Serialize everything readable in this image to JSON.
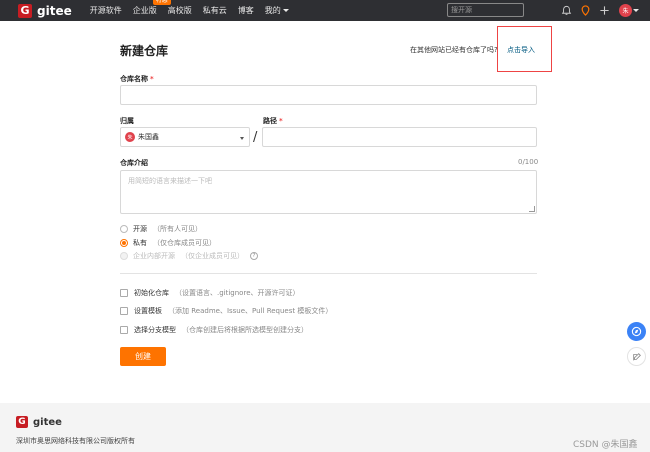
{
  "topbar": {
    "logo_letter": "G",
    "logo_text": "gitee",
    "nav": [
      {
        "label": "开源软件"
      },
      {
        "label": "企业版",
        "badge": "特惠"
      },
      {
        "label": "高校版"
      },
      {
        "label": "私有云"
      },
      {
        "label": "博客"
      },
      {
        "label": "我的"
      }
    ],
    "search_placeholder": "搜开源",
    "avatar_text": "朱"
  },
  "page": {
    "title": "新建仓库",
    "import_question": "在其他网站已经有仓库了吗?",
    "import_link": "点击导入"
  },
  "form": {
    "repo_name_label": "仓库名称",
    "required_mark": "*",
    "owner_label": "归属",
    "owner_avatar": "朱",
    "owner_name": "朱国鑫",
    "path_label": "路径",
    "path_separator": "/",
    "intro_label": "仓库介绍",
    "intro_counter": "0/100",
    "intro_placeholder": "用简短的语言来描述一下吧",
    "visibility": [
      {
        "label": "开源",
        "hint": "（所有人可见）",
        "state": "off"
      },
      {
        "label": "私有",
        "hint": "（仅仓库成员可见）",
        "state": "on"
      },
      {
        "label": "企业内部开源",
        "hint": "（仅企业成员可见）",
        "state": "disabled"
      }
    ],
    "options": [
      {
        "label": "初始化仓库",
        "hint": "（设置语言、.gitignore、开源许可证）"
      },
      {
        "label": "设置模板",
        "hint": "（添加 Readme、Issue、Pull Request 模板文件）"
      },
      {
        "label": "选择分支模型",
        "hint": "（仓库创建后将根据所选模型创建分支）"
      }
    ],
    "create_label": "创建"
  },
  "footer": {
    "logo_letter": "G",
    "logo_text": "gitee",
    "copyright": "深圳市奥思网络科技有限公司版权所有"
  },
  "watermark": "CSDN @朱国鑫",
  "colors": {
    "brand_red": "#c71d23",
    "accent_orange": "#fe7300",
    "topbar": "#2e2f33",
    "link": "#005980"
  }
}
